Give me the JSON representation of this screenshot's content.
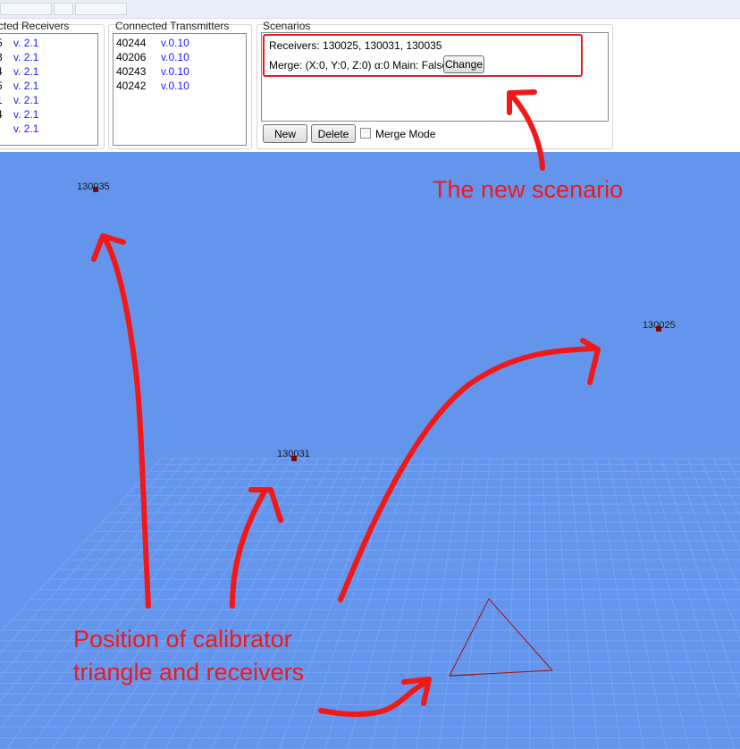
{
  "panels": {
    "receivers": {
      "title": "cted Receivers",
      "rows": [
        {
          "id": "5",
          "version": "v. 2.1"
        },
        {
          "id": "3",
          "version": "v. 2.1"
        },
        {
          "id": "4",
          "version": "v. 2.1"
        },
        {
          "id": "5",
          "version": "v. 2.1"
        },
        {
          "id": "1",
          "version": "v. 2.1"
        },
        {
          "id": "4",
          "version": "v. 2.1"
        },
        {
          "id": "",
          "version": "v. 2.1"
        }
      ]
    },
    "transmitters": {
      "title": "Connected Transmitters",
      "rows": [
        {
          "id": "40244",
          "version": "v.0.10"
        },
        {
          "id": "40206",
          "version": "v.0.10"
        },
        {
          "id": "40243",
          "version": "v.0.10"
        },
        {
          "id": "40242",
          "version": "v.0.10"
        }
      ]
    },
    "scenarios": {
      "title": "Scenarios",
      "item": {
        "receivers_text": "Receivers: 130025, 130031, 130035",
        "merge_text": "Merge:  (X:0, Y:0, Z:0) α:0 Main:  False",
        "change_label": "Change"
      },
      "new_label": "New",
      "delete_label": "Delete",
      "merge_mode_label": "Merge Mode",
      "merge_mode_checked": false
    }
  },
  "viewport": {
    "background": "#6495ED",
    "receivers": [
      {
        "label": "130035"
      },
      {
        "label": "130025"
      },
      {
        "label": "130031"
      }
    ]
  },
  "annotations": {
    "new_scenario": "The new scenario",
    "position_line1": "Position of calibrator",
    "position_line2": "triangle and receivers",
    "color": "#f21818"
  }
}
